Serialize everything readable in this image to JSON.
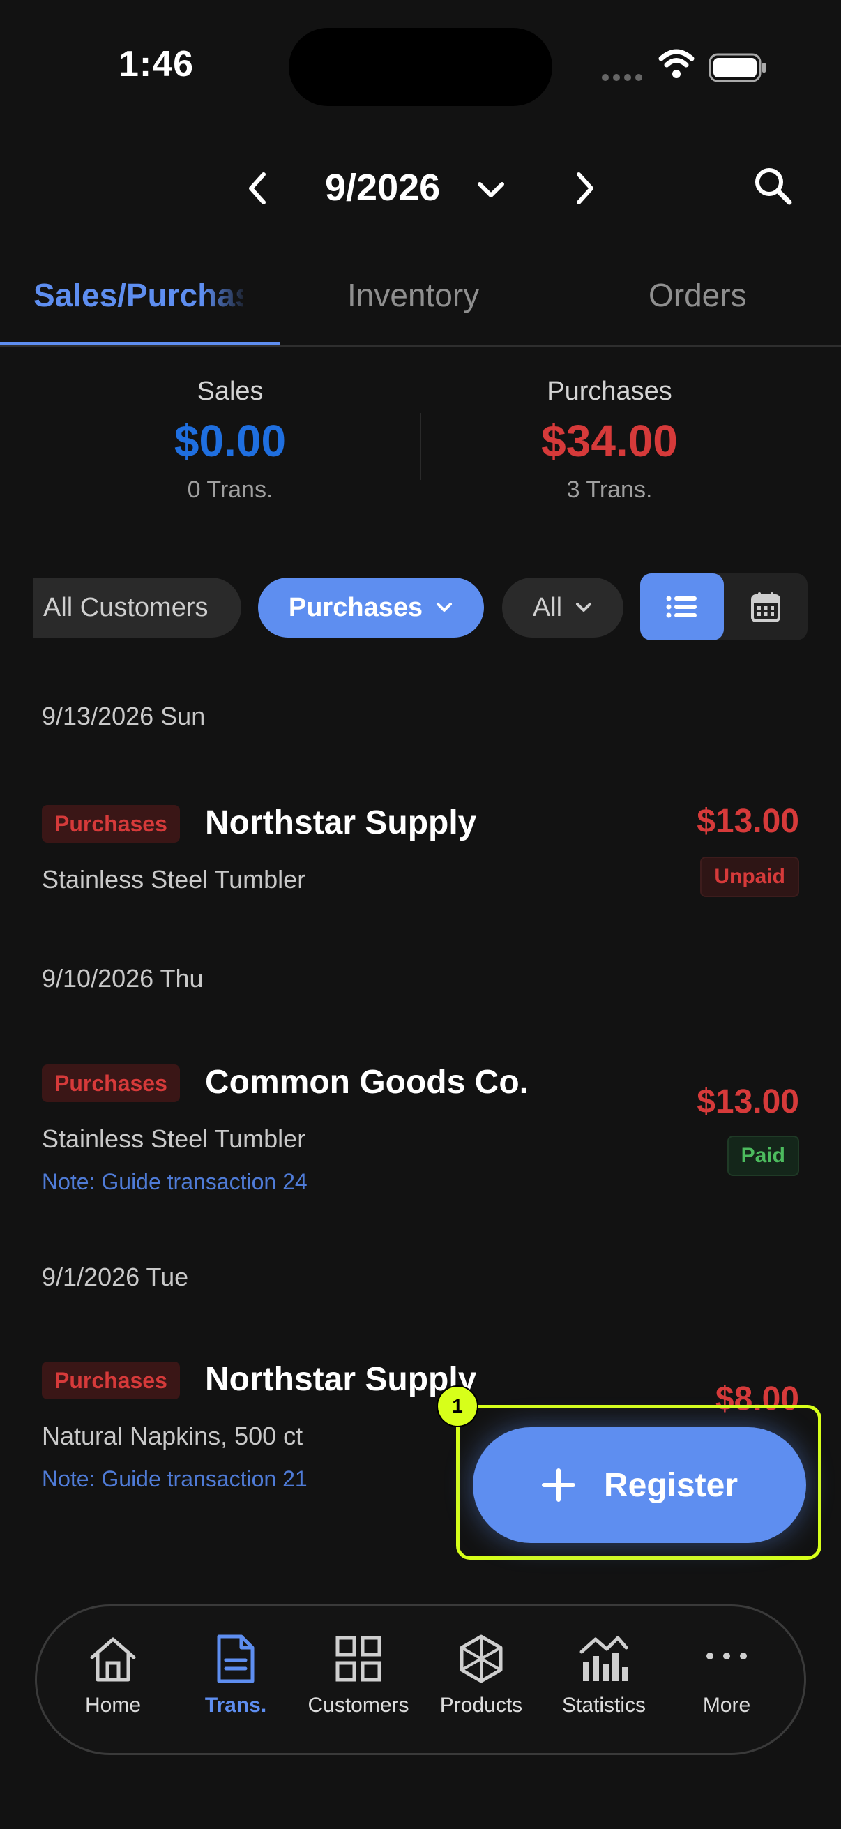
{
  "status_bar": {
    "time": "1:46"
  },
  "header": {
    "month": "9/2026"
  },
  "tabs": [
    {
      "label": "Sales/Purchases",
      "active": true
    },
    {
      "label": "Inventory",
      "active": false
    },
    {
      "label": "Orders",
      "active": false
    }
  ],
  "summary": {
    "sales": {
      "label": "Sales",
      "amount": "$0.00",
      "count": "0 Trans."
    },
    "purchases": {
      "label": "Purchases",
      "amount": "$34.00",
      "count": "3 Trans."
    }
  },
  "filters": {
    "customer": "All Customers",
    "type": "Purchases",
    "status": "All"
  },
  "groups": [
    {
      "date": "9/13/2026 Sun",
      "transactions": [
        {
          "type": "Purchases",
          "name": "Northstar Supply",
          "item": "Stainless Steel Tumbler",
          "note": "",
          "amount": "$13.00",
          "status": "Unpaid"
        }
      ]
    },
    {
      "date": "9/10/2026 Thu",
      "transactions": [
        {
          "type": "Purchases",
          "name": "Common Goods Co.",
          "item": "Stainless Steel Tumbler",
          "note": "Note: Guide transaction 24",
          "amount": "$13.00",
          "status": "Paid"
        }
      ]
    },
    {
      "date": "9/1/2026 Tue",
      "transactions": [
        {
          "type": "Purchases",
          "name": "Northstar Supply",
          "item": "Natural Napkins, 500 ct",
          "note": "Note: Guide transaction 21",
          "amount": "$8.00",
          "status": ""
        }
      ]
    }
  ],
  "fab": {
    "label": "Register",
    "marker": "1"
  },
  "nav": [
    {
      "label": "Home",
      "icon": "home-icon",
      "active": false
    },
    {
      "label": "Trans.",
      "icon": "document-icon",
      "active": true
    },
    {
      "label": "Customers",
      "icon": "grid-icon",
      "active": false
    },
    {
      "label": "Products",
      "icon": "cube-icon",
      "active": false
    },
    {
      "label": "Statistics",
      "icon": "chart-icon",
      "active": false
    },
    {
      "label": "More",
      "icon": "more-icon",
      "active": false
    }
  ],
  "colors": {
    "accent": "#5e8ef0",
    "sales": "#1f6fe0",
    "purchases": "#d63a3a",
    "paid": "#4cbb5e",
    "highlight": "#d7ff1a"
  }
}
